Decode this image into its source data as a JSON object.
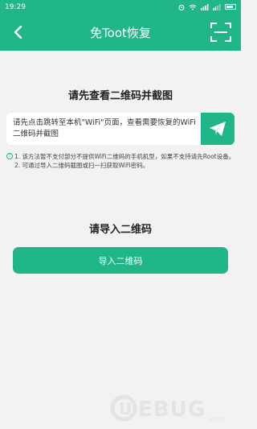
{
  "status_bar": {
    "time": "19:29"
  },
  "header": {
    "title": "免Toot恢复"
  },
  "section1": {
    "title": "请先查看二维码并截图"
  },
  "card": {
    "text": "请先点击跳转至本机\"WiFi\"页面，查看需要恢复的WiFi二维码并截图"
  },
  "notes": [
    "1. 该方法暂不支付部分不提供WiFi二维码的手机机型，如果不支持请先Root设备。",
    "2. 可通过导入二维码截图或扫一扫获取WiFi密码。"
  ],
  "section2": {
    "title": "请导入二维码"
  },
  "import_button": {
    "label": "导入二维码"
  },
  "watermark": {
    "brand": "UEBUG",
    "sub": ".com"
  },
  "colors": {
    "accent": "#21b58a",
    "background": "#f2f2f2"
  }
}
